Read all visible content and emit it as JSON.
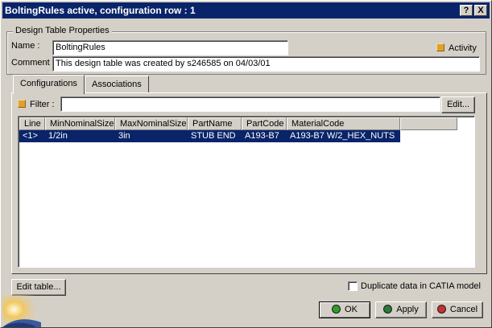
{
  "window": {
    "title": "BoltingRules active, configuration row : 1",
    "help_label": "?",
    "close_label": "X"
  },
  "properties": {
    "group_title": "Design Table Properties",
    "name_label": "Name :",
    "name_value": "BoltingRules",
    "comment_label": "Comment :",
    "comment_value": "This design table was created by s246585 on 04/03/01",
    "activity_label": "Activity"
  },
  "tabs": [
    {
      "label": "Configurations"
    },
    {
      "label": "Associations"
    }
  ],
  "filter": {
    "label": "Filter :",
    "value": "",
    "edit_label": "Edit..."
  },
  "table": {
    "columns": [
      "Line",
      "MinNominalSize",
      "MaxNominalSize",
      "PartName",
      "PartCode",
      "MaterialCode"
    ],
    "rows": [
      [
        "<1>",
        "1/2in",
        "3in",
        "STUB END",
        "A193-B7",
        "A193-B7 W/2_HEX_NUTS"
      ]
    ]
  },
  "edit_table_label": "Edit table...",
  "duplicate": {
    "label": "Duplicate data in CATIA model",
    "checked": false
  },
  "buttons": {
    "ok": "OK",
    "apply": "Apply",
    "cancel": "Cancel"
  },
  "colors": {
    "titlebar": "#0a246a",
    "selection": "#0a246a",
    "face": "#d4d0c8",
    "ok_icon": "#2e9e2e",
    "apply_icon": "#2a7a3a",
    "cancel_icon": "#c83030"
  }
}
